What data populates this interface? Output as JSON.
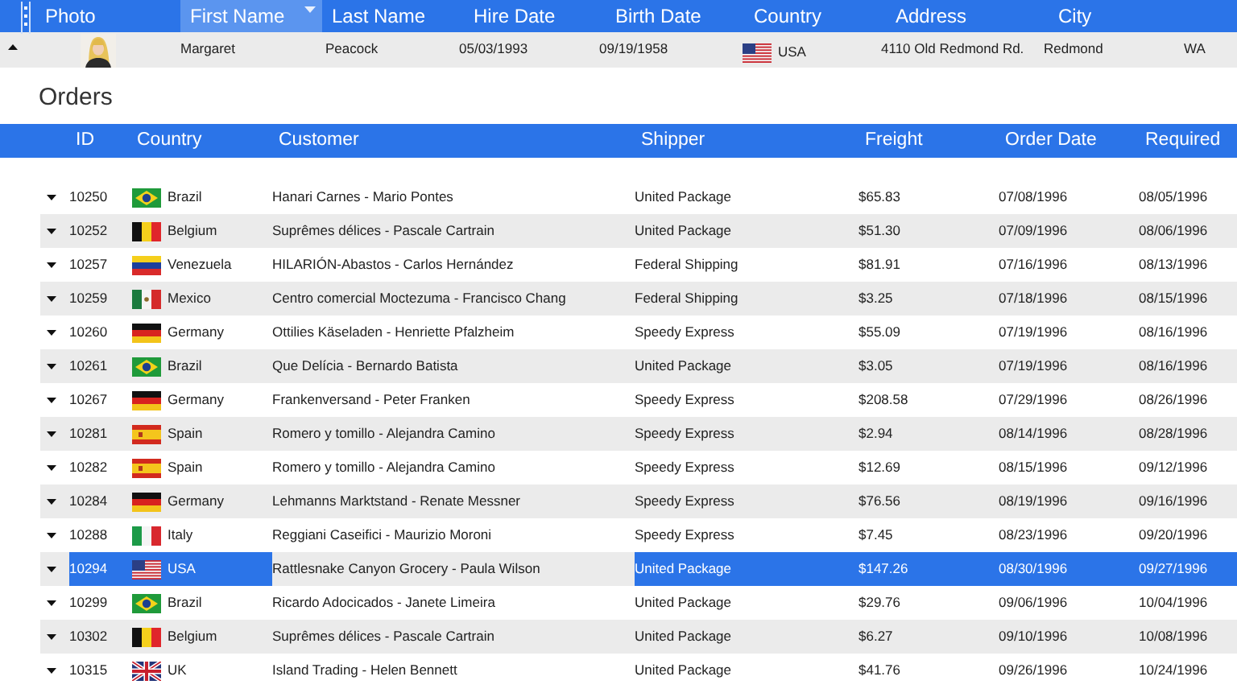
{
  "employee_grid": {
    "columns": [
      {
        "label": "Photo",
        "highlighted": false
      },
      {
        "label": "First Name",
        "highlighted": true
      },
      {
        "label": "Last Name",
        "highlighted": false
      },
      {
        "label": "Hire Date",
        "highlighted": false
      },
      {
        "label": "Birth Date",
        "highlighted": false
      },
      {
        "label": "Country",
        "highlighted": false
      },
      {
        "label": "Address",
        "highlighted": false
      },
      {
        "label": "City",
        "highlighted": false
      }
    ],
    "row": {
      "expanded": true,
      "first_name": "Margaret",
      "last_name": "Peacock",
      "hire_date": "05/03/1993",
      "birth_date": "09/19/1958",
      "kind": "us",
      "country": "USA",
      "address": "4110 Old Redmond Rd.",
      "city": "Redmond",
      "column_9": "WA"
    }
  },
  "orders": {
    "title": "Orders",
    "columns": [
      "ID",
      "Country",
      "Customer",
      "Shipper",
      "Freight",
      "Order Date",
      "Required"
    ],
    "rows": [
      {
        "expanded": false,
        "selected": false,
        "id": "10250",
        "kind": "br",
        "country": "Brazil",
        "customer": "Hanari Carnes - Mario Pontes",
        "shipper": "United Package",
        "freight": "$65.83",
        "order_date": "07/08/1996",
        "required": "08/05/1996"
      },
      {
        "expanded": false,
        "selected": false,
        "id": "10252",
        "kind": "be",
        "country": "Belgium",
        "customer": "Suprêmes délices - Pascale Cartrain",
        "shipper": "United Package",
        "freight": "$51.30",
        "order_date": "07/09/1996",
        "required": "08/06/1996"
      },
      {
        "expanded": false,
        "selected": false,
        "id": "10257",
        "kind": "ve",
        "country": "Venezuela",
        "customer": "HILARIÓN-Abastos - Carlos Hernández",
        "shipper": "Federal Shipping",
        "freight": "$81.91",
        "order_date": "07/16/1996",
        "required": "08/13/1996"
      },
      {
        "expanded": false,
        "selected": false,
        "id": "10259",
        "kind": "mx",
        "country": "Mexico",
        "customer": "Centro comercial Moctezuma - Francisco Chang",
        "shipper": "Federal Shipping",
        "freight": "$3.25",
        "order_date": "07/18/1996",
        "required": "08/15/1996"
      },
      {
        "expanded": false,
        "selected": false,
        "id": "10260",
        "kind": "de",
        "country": "Germany",
        "customer": "Ottilies Käseladen - Henriette Pfalzheim",
        "shipper": "Speedy Express",
        "freight": "$55.09",
        "order_date": "07/19/1996",
        "required": "08/16/1996"
      },
      {
        "expanded": false,
        "selected": false,
        "id": "10261",
        "kind": "br",
        "country": "Brazil",
        "customer": "Que Delícia - Bernardo Batista",
        "shipper": "United Package",
        "freight": "$3.05",
        "order_date": "07/19/1996",
        "required": "08/16/1996"
      },
      {
        "expanded": false,
        "selected": false,
        "id": "10267",
        "kind": "de",
        "country": "Germany",
        "customer": "Frankenversand - Peter Franken",
        "shipper": "Speedy Express",
        "freight": "$208.58",
        "order_date": "07/29/1996",
        "required": "08/26/1996"
      },
      {
        "expanded": false,
        "selected": false,
        "id": "10281",
        "kind": "es",
        "country": "Spain",
        "customer": "Romero y tomillo - Alejandra Camino",
        "shipper": "Speedy Express",
        "freight": "$2.94",
        "order_date": "08/14/1996",
        "required": "08/28/1996"
      },
      {
        "expanded": false,
        "selected": false,
        "id": "10282",
        "kind": "es",
        "country": "Spain",
        "customer": "Romero y tomillo - Alejandra Camino",
        "shipper": "Speedy Express",
        "freight": "$12.69",
        "order_date": "08/15/1996",
        "required": "09/12/1996"
      },
      {
        "expanded": false,
        "selected": false,
        "id": "10284",
        "kind": "de",
        "country": "Germany",
        "customer": "Lehmanns Marktstand - Renate Messner",
        "shipper": "Speedy Express",
        "freight": "$76.56",
        "order_date": "08/19/1996",
        "required": "09/16/1996"
      },
      {
        "expanded": false,
        "selected": false,
        "id": "10288",
        "kind": "it",
        "country": "Italy",
        "customer": "Reggiani Caseifici - Maurizio Moroni",
        "shipper": "Speedy Express",
        "freight": "$7.45",
        "order_date": "08/23/1996",
        "required": "09/20/1996"
      },
      {
        "expanded": false,
        "selected": true,
        "id": "10294",
        "kind": "us",
        "country": "USA",
        "customer": "Rattlesnake Canyon Grocery - Paula Wilson",
        "shipper": "United Package",
        "freight": "$147.26",
        "order_date": "08/30/1996",
        "required": "09/27/1996"
      },
      {
        "expanded": false,
        "selected": false,
        "id": "10299",
        "kind": "br",
        "country": "Brazil",
        "customer": "Ricardo Adocicados - Janete Limeira",
        "shipper": "United Package",
        "freight": "$29.76",
        "order_date": "09/06/1996",
        "required": "10/04/1996"
      },
      {
        "expanded": false,
        "selected": false,
        "id": "10302",
        "kind": "be",
        "country": "Belgium",
        "customer": "Suprêmes délices - Pascale Cartrain",
        "shipper": "United Package",
        "freight": "$6.27",
        "order_date": "09/10/1996",
        "required": "10/08/1996"
      },
      {
        "expanded": false,
        "selected": false,
        "id": "10315",
        "kind": "gb",
        "country": "UK",
        "customer": "Island Trading - Helen Bennett",
        "shipper": "United Package",
        "freight": "$41.76",
        "order_date": "09/26/1996",
        "required": "10/24/1996"
      }
    ]
  }
}
